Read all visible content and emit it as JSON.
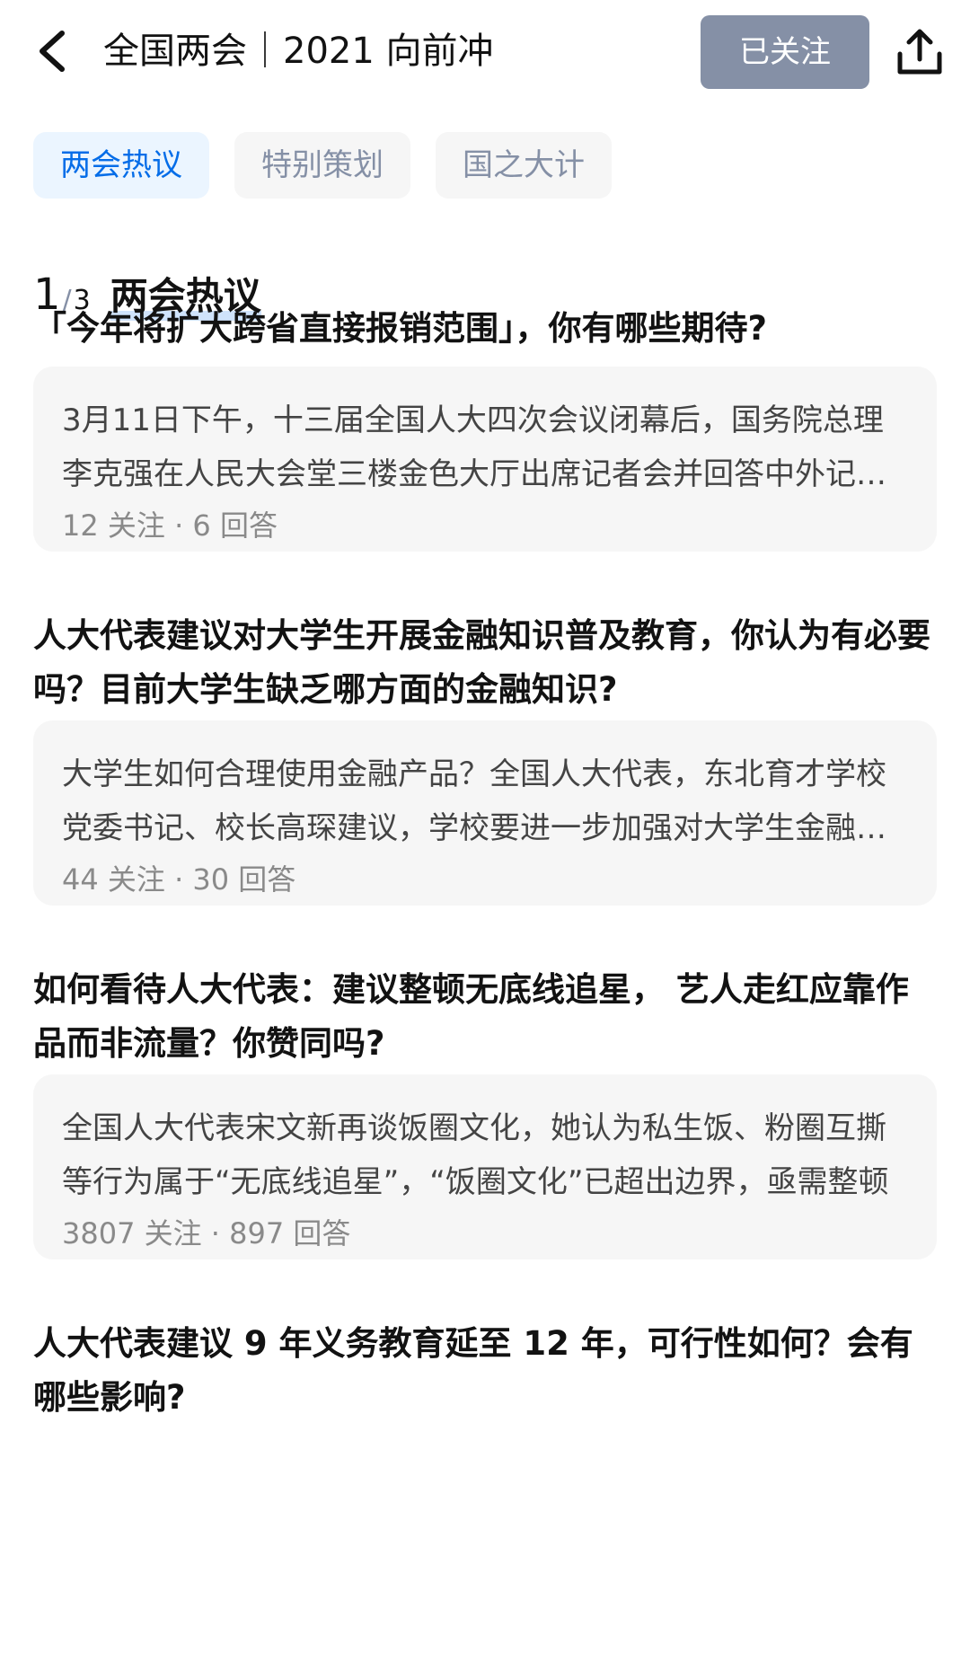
{
  "header": {
    "title": "全国两会｜2021 向前冲",
    "follow_label": "已关注"
  },
  "tabs": [
    {
      "label": "两会热议",
      "active": true
    },
    {
      "label": "特别策划",
      "active": false
    },
    {
      "label": "国之大计",
      "active": false
    }
  ],
  "section": {
    "current": "1",
    "separator": "/",
    "total": "3",
    "title": "两会热议"
  },
  "questions": [
    {
      "title": "「今年将扩大跨省直接报销范围」，你有哪些期待?",
      "excerpt": "3月11日下午，十三届全国人大四次会议闭幕后，国务院总理李克强在人民大会堂三楼金色大厅出席记者会并回答中外记者提问",
      "meta": "12 关注 · 6 回答"
    },
    {
      "title": "人大代表建议对大学生开展金融知识普及教育，你认为有必要吗？目前大学生缺乏哪方面的金融知识?",
      "excerpt": "大学生如何合理使用金融产品？全国人大代表，东北育才学校党委书记、校长高琛建议，学校要进一步加强对大学生金融知识的普及",
      "meta": "44 关注 · 30 回答"
    },
    {
      "title": "如何看待人大代表：建议整顿无底线追星， 艺人走红应靠作品而非流量？你赞同吗?",
      "excerpt": "全国人大代表宋文新再谈饭圈文化，她认为私生饭、粉圈互撕等行为属于“无底线追星”，“饭圈文化”已超出边界，亟需整顿",
      "meta": "3807 关注 · 897 回答"
    },
    {
      "title": "人大代表建议 9 年义务教育延至 12 年，可行性如何？会有哪些影响?"
    }
  ],
  "icons": {
    "back": "chevron-left-icon",
    "share": "share-upload-icon"
  },
  "colors": {
    "accent": "#056de8",
    "follow_bg": "#8590a6",
    "card_bg": "#f6f6f6",
    "tab_active_bg": "#ebf5ff"
  }
}
